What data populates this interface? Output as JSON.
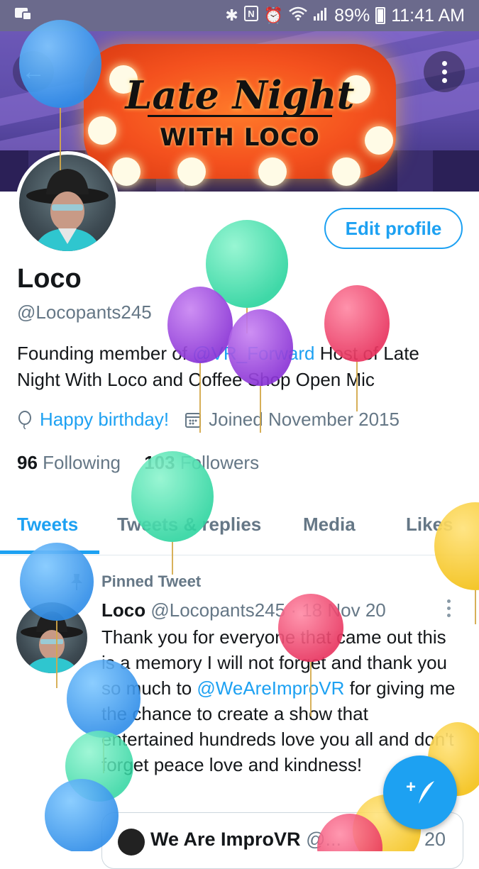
{
  "status_bar": {
    "battery_percent": "89%",
    "time": "11:41 AM"
  },
  "banner": {
    "title_line1": "Late Night",
    "title_line2": "WITH LOCO"
  },
  "profile": {
    "edit_label": "Edit profile",
    "name": "Loco",
    "handle": "@Locopants245",
    "bio_prefix": "Founding member of ",
    "bio_mention": "@VR_Forward",
    "bio_suffix": "  Host of Late Night With Loco and Coffee Shop Open Mic",
    "birthday": "Happy birthday!",
    "joined": "Joined November 2015",
    "following_count": "96",
    "following_label": "Following",
    "followers_count": "103",
    "followers_label": "Followers"
  },
  "tabs": [
    {
      "label": "Tweets",
      "active": true
    },
    {
      "label": "Tweets & replies",
      "active": false
    },
    {
      "label": "Media",
      "active": false
    },
    {
      "label": "Likes",
      "active": false
    }
  ],
  "tweet": {
    "pinned_label": "Pinned Tweet",
    "author": "Loco",
    "handle": "@Locopants245",
    "separator": " · ",
    "date": "18 Nov 20",
    "text_a": "Thank you for everyone that came out this is a memory I will not forget and thank you so much to ",
    "mention": "@WeAreImproVR",
    "text_b": " for giving me the chance to create a show that entertained hundreds love you all and don't forget peace love and kindness!",
    "quote_name": "We Are ImproVR",
    "quote_handle": "@...",
    "quote_date": "20"
  },
  "colors": {
    "accent": "#1da1f2",
    "secondary_text": "#657786",
    "status_bar": "#6b6a8c",
    "banner_bg": "#5b4aa6",
    "marquee": "#f4511e"
  },
  "icons": {
    "status_left": "app-notification-icon",
    "status_right": [
      "bluetooth-icon",
      "nfc-icon",
      "alarm-icon",
      "wifi-icon",
      "signal-icon",
      "battery-icon"
    ],
    "back": "back-arrow-icon",
    "overflow": "more-vertical-icon",
    "birthday": "balloon-icon",
    "joined": "calendar-icon",
    "pin": "pin-icon",
    "fab": "compose-tweet-icon"
  }
}
